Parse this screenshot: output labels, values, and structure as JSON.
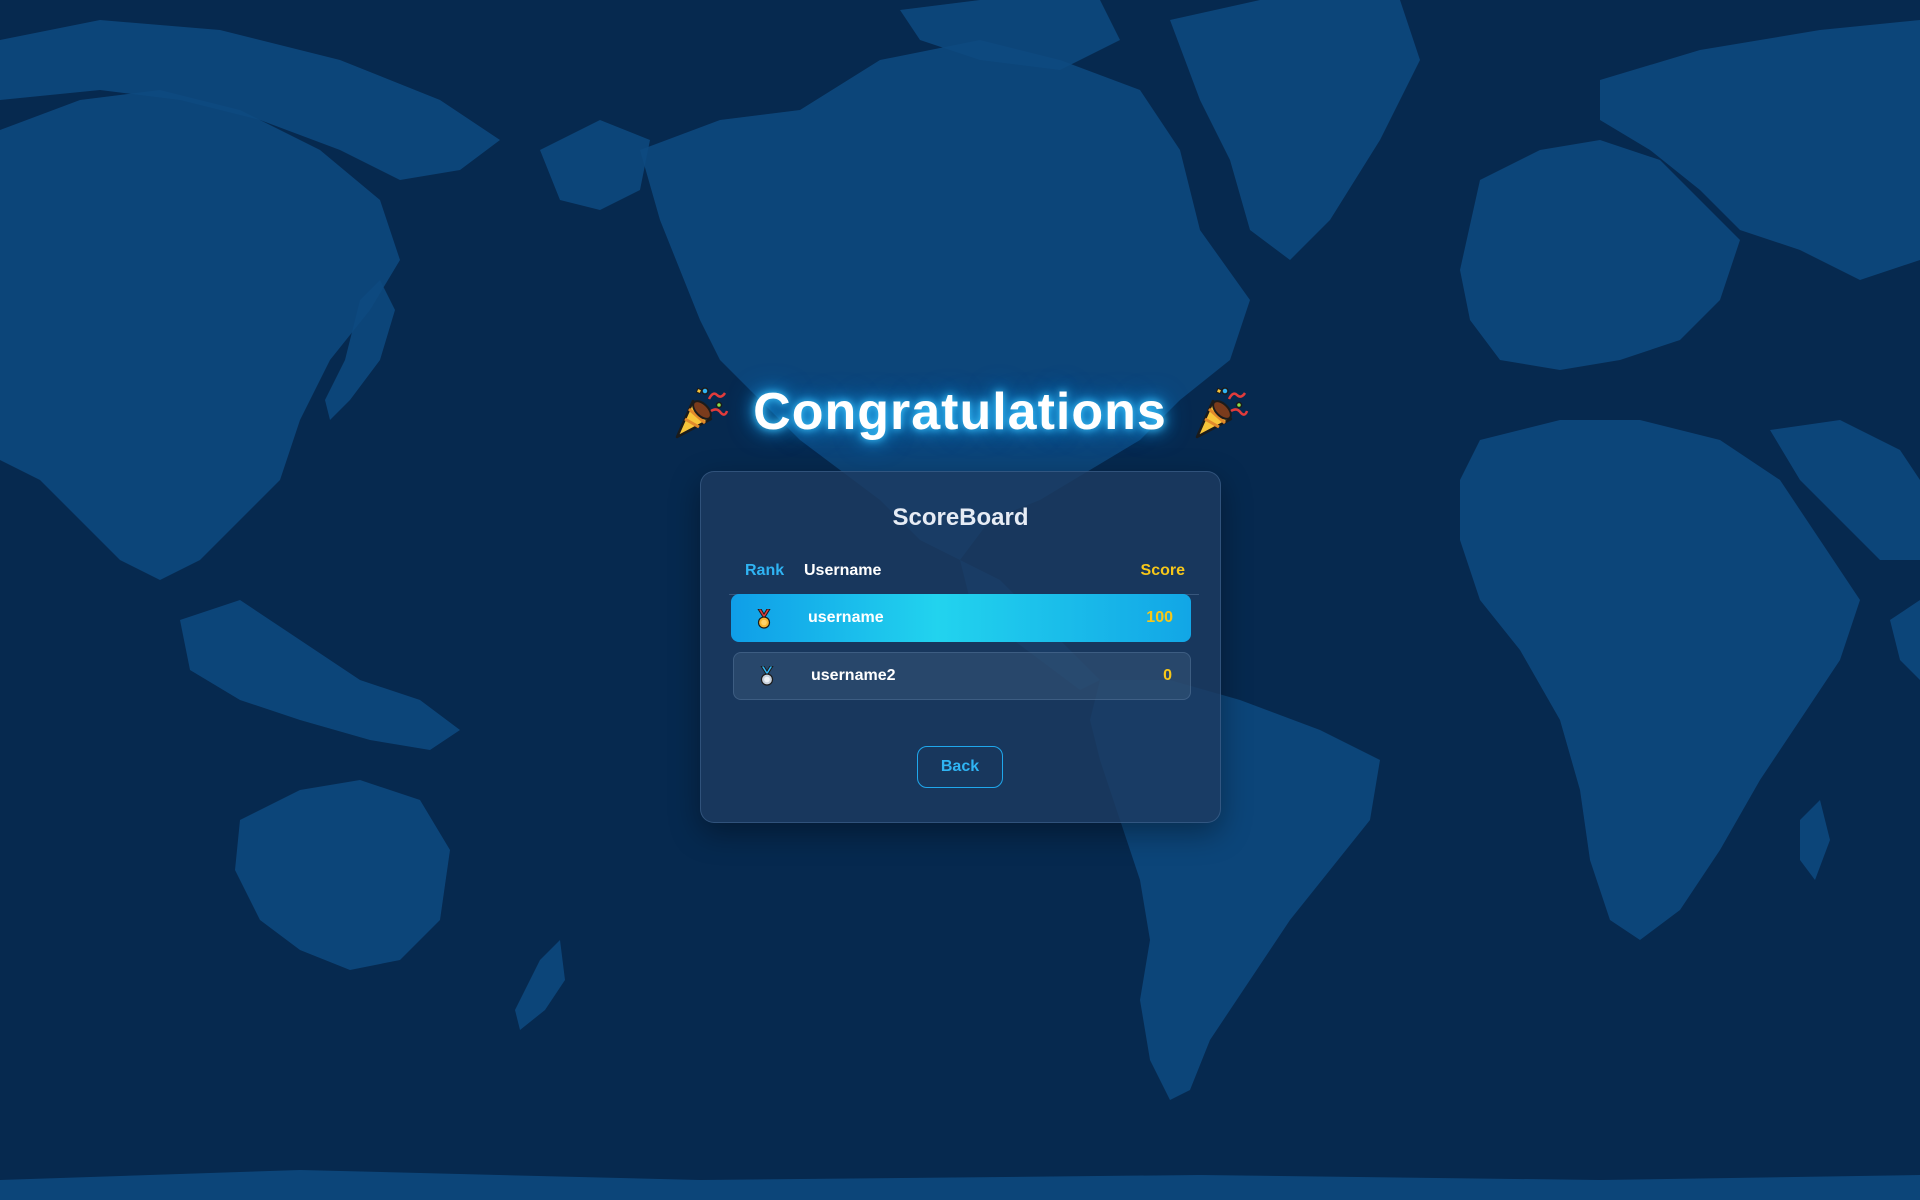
{
  "title": {
    "text": "Congratulations",
    "left_icon": "party-popper-icon",
    "right_icon": "party-popper-icon"
  },
  "scoreboard": {
    "title": "ScoreBoard",
    "columns": {
      "rank": "Rank",
      "username": "Username",
      "score": "Score"
    },
    "rows": [
      {
        "rank_icon": "gold-medal-icon",
        "username": "username",
        "score": "100"
      },
      {
        "rank_icon": "silver-medal-icon",
        "username": "username2",
        "score": "0"
      }
    ],
    "back_label": "Back"
  },
  "colors": {
    "background": "#06294f",
    "map_land": "#0e4a80",
    "accent_blue": "#2fb4f4",
    "score_yellow": "#f7c719",
    "highlight_row_start": "#0f9ee8",
    "highlight_row_mid": "#22d3ee"
  }
}
